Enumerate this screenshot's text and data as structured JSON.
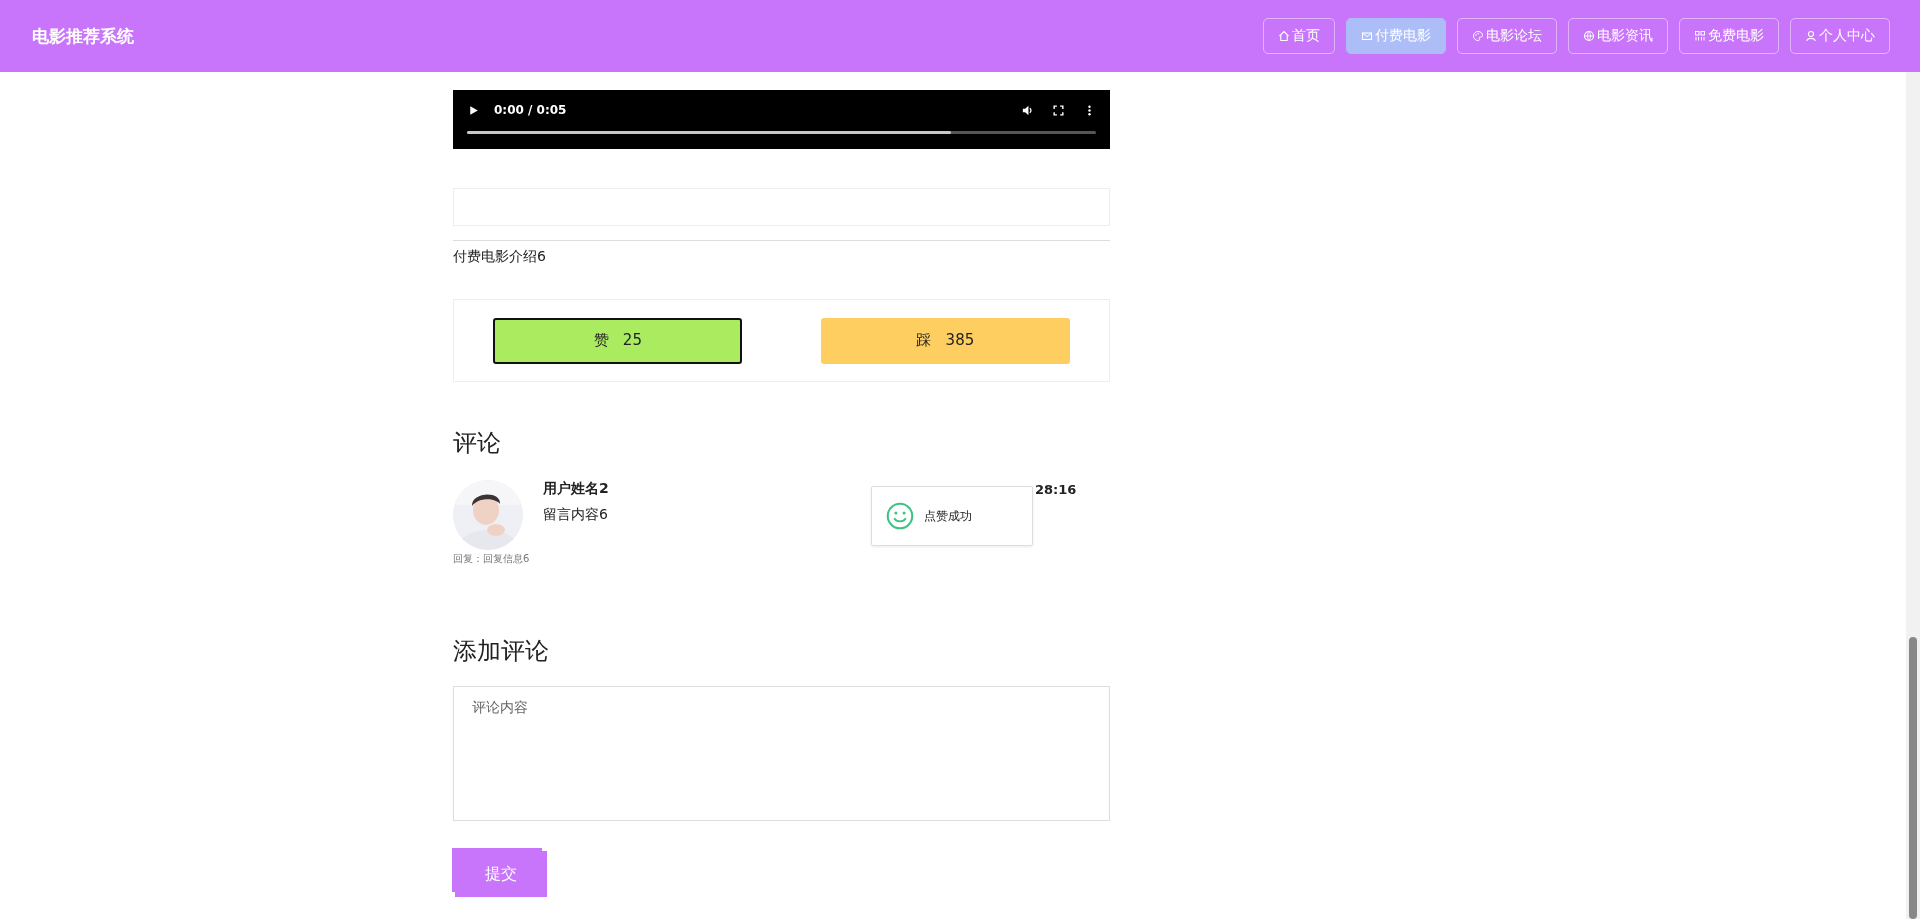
{
  "header": {
    "title": "电影推荐系统",
    "nav": [
      {
        "label": "首页",
        "selected": false
      },
      {
        "label": "付费电影",
        "selected": true
      },
      {
        "label": "电影论坛",
        "selected": false
      },
      {
        "label": "电影资讯",
        "selected": false
      },
      {
        "label": "免费电影",
        "selected": false
      },
      {
        "label": "个人中心",
        "selected": false
      }
    ]
  },
  "video": {
    "time": "0:00 / 0:05",
    "level": 0.77
  },
  "intro": "付费电影介绍6",
  "votes": [
    {
      "kind": "like",
      "label": "赞",
      "count": "25",
      "selected": true
    },
    {
      "kind": "dislike",
      "label": "踩",
      "count": "385",
      "selected": false
    }
  ],
  "comments_title": "评论",
  "comments": [
    {
      "user": "用户姓名2",
      "content": "留言内容6",
      "time_visible": "28:16",
      "reply": "回复：回复信息6"
    }
  ],
  "toast": "点赞成功",
  "add_comment": {
    "title": "添加评论",
    "placeholder": "评论内容",
    "submit": "提交"
  }
}
